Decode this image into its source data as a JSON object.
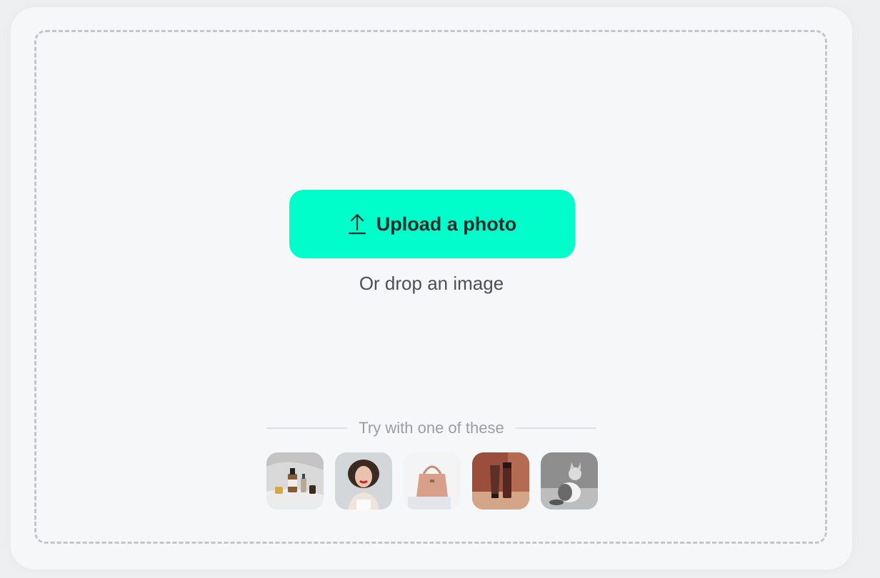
{
  "upload": {
    "button_label": "Upload a photo",
    "icon": "upload-arrow-icon",
    "drop_hint": "Or drop an image"
  },
  "samples": {
    "heading": "Try with one of these",
    "items": [
      {
        "name": "skincare-bottles",
        "alt": "Skincare bottles"
      },
      {
        "name": "smiling-woman",
        "alt": "Smiling woman with curly hair"
      },
      {
        "name": "pink-handbag",
        "alt": "Pink handbag"
      },
      {
        "name": "brown-cosmetic-tubes",
        "alt": "Brown cosmetic tubes"
      },
      {
        "name": "kitten",
        "alt": "Kitten"
      }
    ]
  },
  "colors": {
    "accent": "#00fecb",
    "page_bg": "#eeeff1",
    "card_bg": "#f6f7f9",
    "dash_border": "#c4c6c9"
  }
}
